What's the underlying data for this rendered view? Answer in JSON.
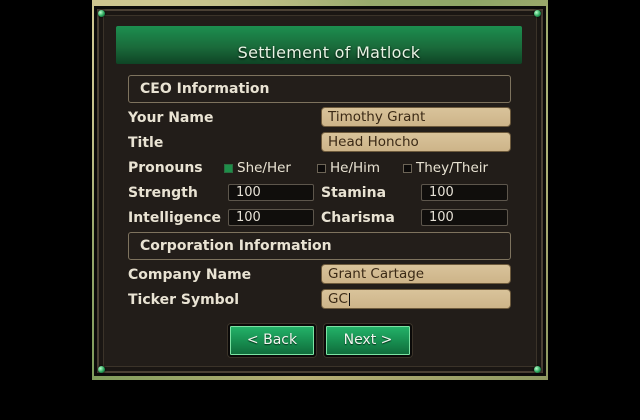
{
  "dialog": {
    "title": "Settlement of Matlock"
  },
  "ceo_section": {
    "title": "CEO Information",
    "your_name_label": "Your Name",
    "your_name_value": "Timothy Grant",
    "title_label": "Title",
    "title_value": "Head Honcho",
    "pronouns_label": "Pronouns",
    "pronoun_options": [
      "She/Her",
      "He/Him",
      "They/Their"
    ],
    "pronoun_selected": "She/Her",
    "strength_label": "Strength",
    "strength_value": "100",
    "stamina_label": "Stamina",
    "stamina_value": "100",
    "intelligence_label": "Intelligence",
    "intelligence_value": "100",
    "charisma_label": "Charisma",
    "charisma_value": "100"
  },
  "corp_section": {
    "title": "Corporation Information",
    "company_name_label": "Company Name",
    "company_name_value": "Grant Cartage",
    "ticker_label": "Ticker Symbol",
    "ticker_value": "GC"
  },
  "buttons": {
    "back_label": "< Back",
    "next_label": "Next >"
  },
  "colors": {
    "accent_green": "#1a8c4e",
    "field_tan": "#d4bd92",
    "panel_dark": "#221d19"
  }
}
